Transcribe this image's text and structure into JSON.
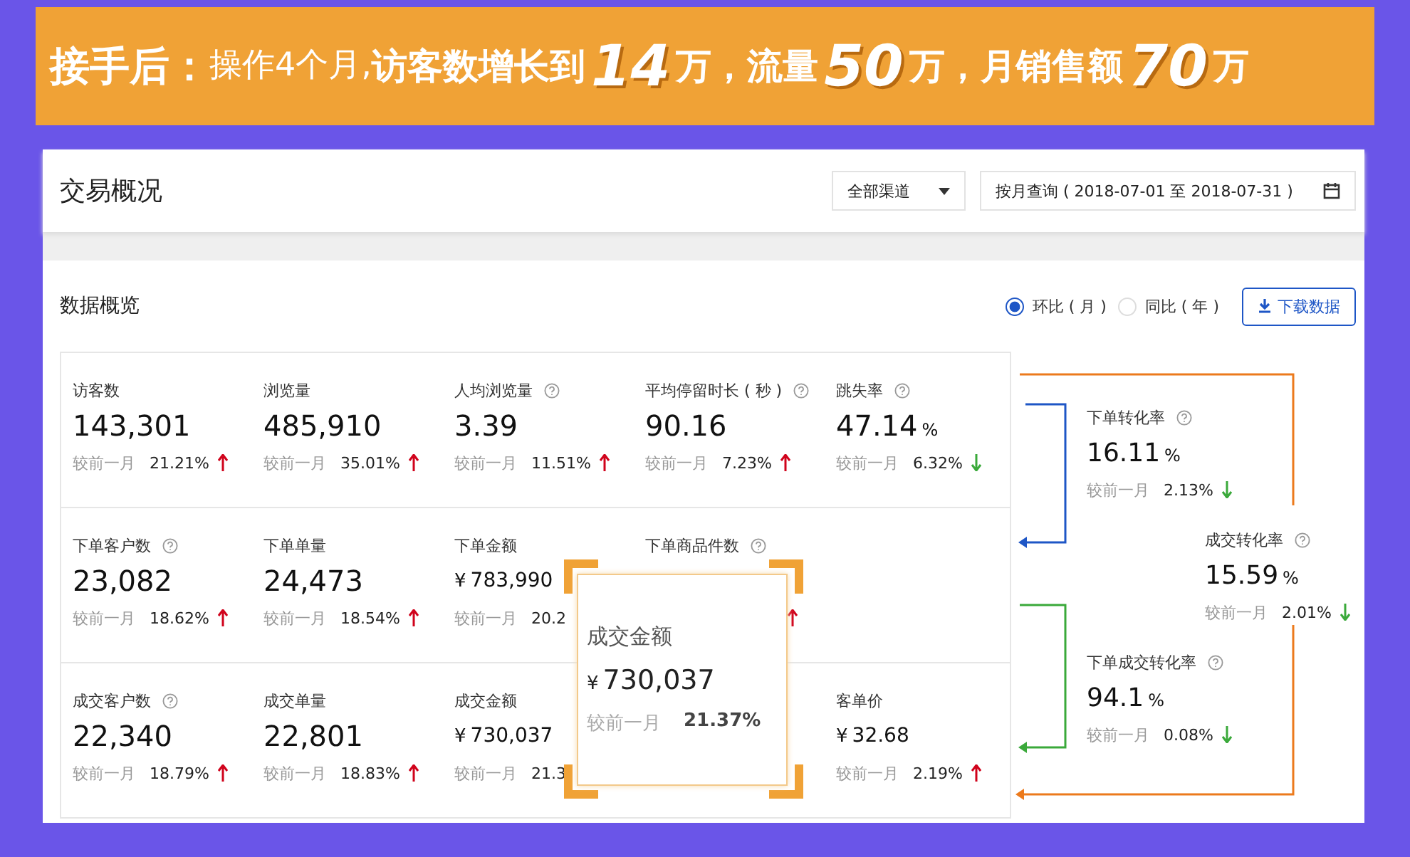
{
  "banner": {
    "segments": [
      {
        "kind": "lead",
        "text": "接手后："
      },
      {
        "kind": "plain",
        "text": "操作4个月,"
      },
      {
        "kind": "bold",
        "text": "访客数增长到"
      },
      {
        "kind": "number",
        "text": "14"
      },
      {
        "kind": "bold",
        "text": "万，流量"
      },
      {
        "kind": "number",
        "text": "50"
      },
      {
        "kind": "bold",
        "text": "万，月销售额"
      },
      {
        "kind": "number",
        "text": "70"
      },
      {
        "kind": "bold",
        "text": "万"
      }
    ]
  },
  "header": {
    "title": "交易概况",
    "channel_select": {
      "value": "全部渠道"
    },
    "date_picker": {
      "value": "按月查询 ( 2018-07-01 至 2018-07-31 )"
    }
  },
  "overview": {
    "title": "数据概览",
    "compare": [
      {
        "label": "环比 ( 月 )",
        "selected": true
      },
      {
        "label": "同比 ( 年 )",
        "selected": false
      }
    ],
    "download_button": "下载数据"
  },
  "metric_rows": [
    [
      {
        "label": "访客数",
        "help": false,
        "value": "143,301",
        "compare_label": "较前一月",
        "change": "21.21%",
        "rising": true
      },
      {
        "label": "浏览量",
        "help": false,
        "value": "485,910",
        "compare_label": "较前一月",
        "change": "35.01%",
        "rising": true
      },
      {
        "label": "人均浏览量",
        "help": true,
        "value": "3.39",
        "compare_label": "较前一月",
        "change": "11.51%",
        "rising": true
      },
      {
        "label": "平均停留时长 ( 秒 )",
        "help": true,
        "value": "90.16",
        "compare_label": "较前一月",
        "change": "7.23%",
        "rising": true
      },
      {
        "label": "跳失率",
        "help": true,
        "value": "47.14",
        "unit": "%",
        "compare_label": "较前一月",
        "change": "6.32%",
        "rising": false
      }
    ],
    [
      {
        "label": "下单客户数",
        "help": true,
        "value": "23,082",
        "compare_label": "较前一月",
        "change": "18.62%",
        "rising": true
      },
      {
        "label": "下单单量",
        "help": false,
        "value": "24,473",
        "compare_label": "较前一月",
        "change": "18.54%",
        "rising": true
      },
      {
        "label": "下单金额",
        "help": false,
        "currency": "¥",
        "value": "783,990",
        "compare_label": "较前一月",
        "change": "20.2"
      },
      {
        "label": "下单商品件数",
        "help": true,
        "rising": true
      },
      {}
    ],
    [
      {
        "label": "成交客户数",
        "help": true,
        "value": "22,340",
        "compare_label": "较前一月",
        "change": "18.79%",
        "rising": true
      },
      {
        "label": "成交单量",
        "help": false,
        "value": "22,801",
        "compare_label": "较前一月",
        "change": "18.83%",
        "rising": true
      },
      {
        "label": "成交金额",
        "help": false,
        "currency": "¥",
        "value": "730,037",
        "compare_label": "较前一月",
        "change": "21.3"
      },
      {},
      {
        "label": "客单价",
        "help": false,
        "currency": "¥",
        "value": "32.68",
        "compare_label": "较前一月",
        "change": "2.19%",
        "rising": true
      }
    ]
  ],
  "popup": {
    "label": "成交金额",
    "currency": "¥",
    "value": "730,037",
    "compare_label": "较前一月",
    "change": "21.37%"
  },
  "funnel": [
    {
      "label": "下单转化率",
      "help": true,
      "value": "16.11",
      "unit": "%",
      "compare_label": "较前一月",
      "change": "2.13%",
      "rising": false
    },
    {
      "label": "成交转化率",
      "help": true,
      "value": "15.59",
      "unit": "%",
      "compare_label": "较前一月",
      "change": "2.01%",
      "rising": false
    },
    {
      "label": "下单成交转化率",
      "help": true,
      "value": "94.1",
      "unit": "%",
      "compare_label": "较前一月",
      "change": "0.08%",
      "rising": false
    }
  ]
}
